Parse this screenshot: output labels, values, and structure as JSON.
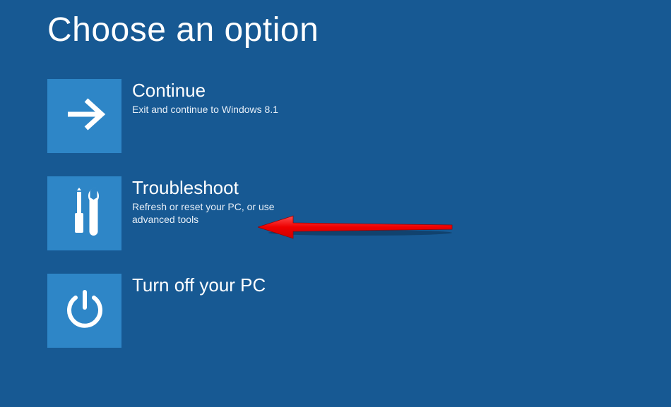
{
  "title": "Choose an option",
  "options": [
    {
      "icon": "arrow-right-icon",
      "title": "Continue",
      "description": "Exit and continue to Windows 8.1"
    },
    {
      "icon": "tools-icon",
      "title": "Troubleshoot",
      "description": "Refresh or reset your PC, or use advanced tools"
    },
    {
      "icon": "power-icon",
      "title": "Turn off your PC",
      "description": ""
    }
  ],
  "annotation": {
    "type": "red-arrow",
    "target": "troubleshoot"
  },
  "colors": {
    "background": "#175993",
    "tile": "#2e86c7",
    "text": "#ffffff",
    "annotation": "#ff0000"
  }
}
